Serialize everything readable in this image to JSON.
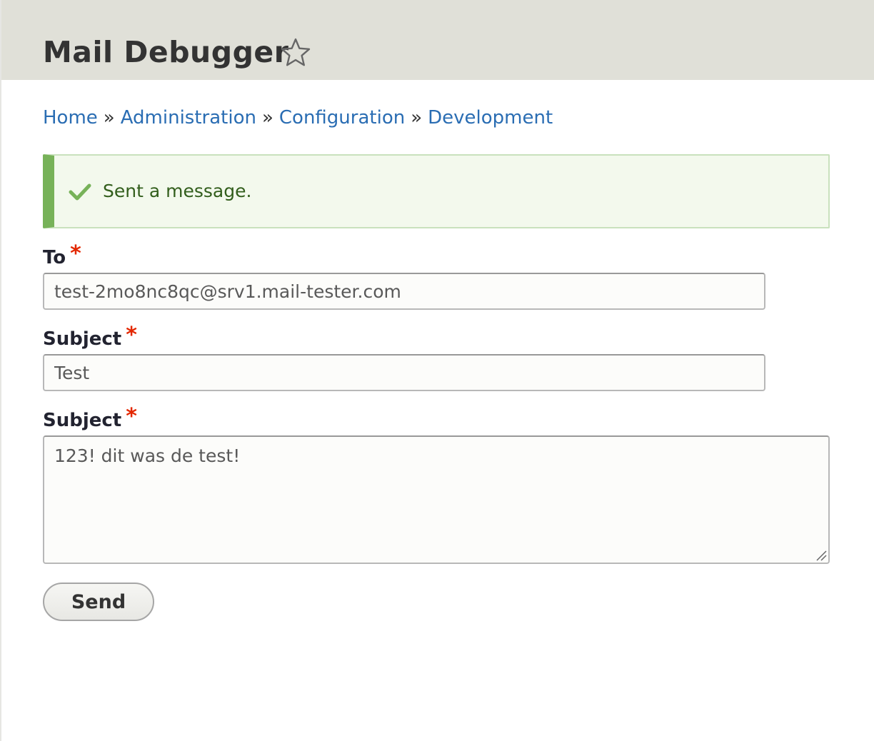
{
  "header": {
    "title": "Mail Debugger",
    "favorite_icon": "star-outline-icon"
  },
  "breadcrumb": {
    "items": [
      "Home",
      "Administration",
      "Configuration",
      "Development"
    ],
    "separator": "»"
  },
  "status": {
    "message": "Sent a message.",
    "icon": "checkmark-icon",
    "accent_color": "#77b259"
  },
  "form": {
    "to": {
      "label": "To",
      "required_marker": "*",
      "value": "test-2mo8nc8qc@srv1.mail-tester.com"
    },
    "subject": {
      "label": "Subject",
      "required_marker": "*",
      "value": "Test"
    },
    "body": {
      "label": "Subject",
      "required_marker": "*",
      "value": "123! dit was de test!"
    },
    "submit_label": "Send"
  },
  "colors": {
    "link": "#2a6db3",
    "required": "#e32700",
    "header_bg": "#e0e0d8"
  }
}
